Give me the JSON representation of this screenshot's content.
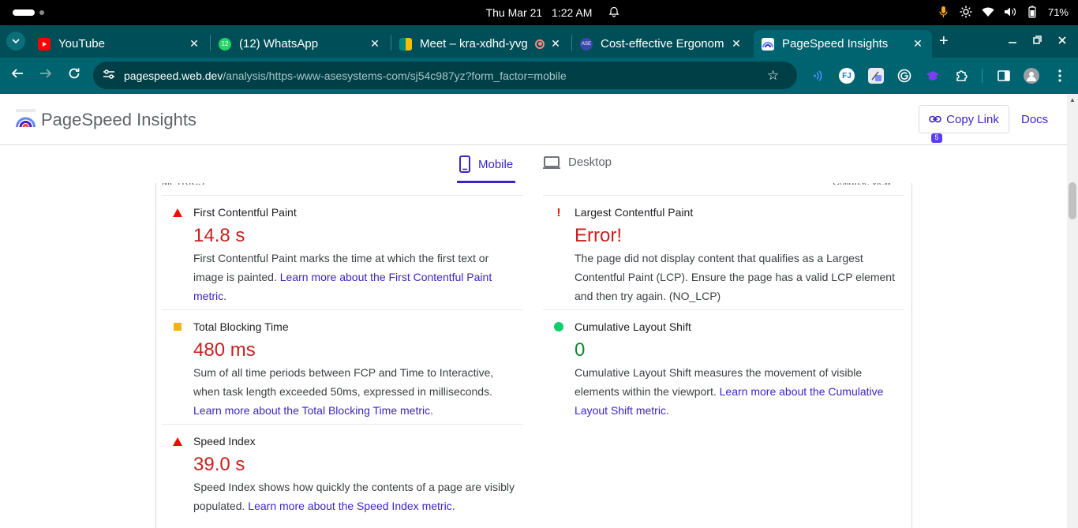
{
  "os": {
    "clock": {
      "day": "Thu Mar 21",
      "time": "1:22 AM"
    },
    "battery": "71%"
  },
  "tabs": [
    {
      "title": "YouTube",
      "favicon_color": "#ff0000"
    },
    {
      "title": "(12) WhatsApp",
      "favicon_color": "#25d366",
      "favicon_text": "12"
    },
    {
      "title": "Meet – kra-xdhd-yvg",
      "favicon_color": "#00897b"
    },
    {
      "title": "Cost-effective Ergonom",
      "favicon_color": "#3949ab",
      "favicon_text": "ASE"
    },
    {
      "title": "PageSpeed Insights",
      "favicon_color": "#5b8def",
      "active": true
    }
  ],
  "toolbar": {
    "url_domain": "pagespeed.web.dev",
    "url_path": "/analysis/https-www-asesystems-com/sj54c987yz?form_factor=mobile",
    "extension_badge": "5"
  },
  "psi": {
    "title": "PageSpeed Insights",
    "copy_link": "Copy Link",
    "docs": "Docs",
    "tabs": {
      "mobile": "Mobile",
      "desktop": "Desktop"
    },
    "clipped_left": "METRICS",
    "clipped_right": "Collapse view"
  },
  "metrics": {
    "fcp": {
      "name": "First Contentful Paint",
      "value": "14.8 s",
      "desc": "First Contentful Paint marks the time at which the first text or image is painted. ",
      "link": "Learn more about the First Contentful Paint metric",
      "tail": "."
    },
    "lcp": {
      "name": "Largest Contentful Paint",
      "value": "Error!",
      "desc": "The page did not display content that qualifies as a Largest Contentful Paint (LCP). Ensure the page has a valid LCP element and then try again. (NO_LCP)"
    },
    "tbt": {
      "name": "Total Blocking Time",
      "value": "480 ms",
      "desc": "Sum of all time periods between FCP and Time to Interactive, when task length exceeded 50ms, expressed in milliseconds. ",
      "link": "Learn more about the Total Blocking Time metric",
      "tail": "."
    },
    "cls": {
      "name": "Cumulative Layout Shift",
      "value": "0",
      "desc": "Cumulative Layout Shift measures the movement of visible elements within the viewport. ",
      "link": "Learn more about the Cumulative Layout Shift metric",
      "tail": "."
    },
    "si": {
      "name": "Speed Index",
      "value": "39.0 s",
      "desc": "Speed Index shows how quickly the contents of a page are visibly populated. ",
      "link": "Learn more about the Speed Index metric",
      "tail": "."
    }
  },
  "colors": {
    "accent": "#3c25c4",
    "fail": "#eb0f00",
    "average": "#f4b400",
    "pass": "#0cce6b",
    "browser_frame": "#006470"
  }
}
